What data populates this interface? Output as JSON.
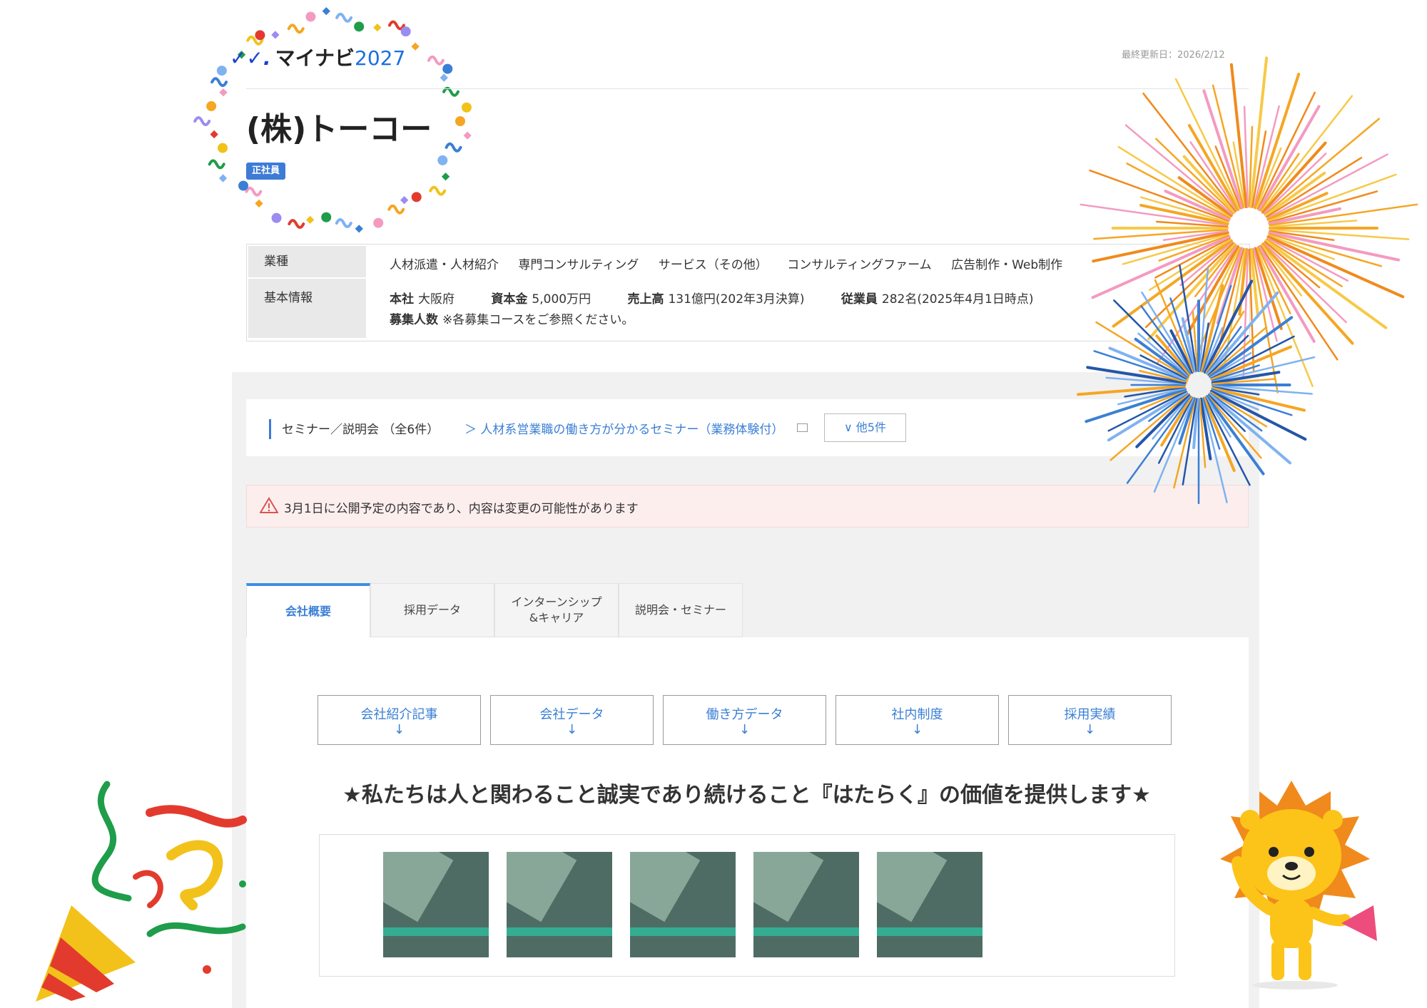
{
  "brand": {
    "logo_text": "マイナビ",
    "logo_year": "2027"
  },
  "last_updated": "最終更新日：2026/2/12",
  "company": {
    "name": "(株)トーコー",
    "employment_type": "正社員"
  },
  "info": {
    "industry_label": "業種",
    "industries": [
      "人材派遣・人材紹介",
      "専門コンサルティング",
      "サービス（その他）",
      "コンサルティングファーム",
      "広告制作・Web制作"
    ],
    "basic_label": "基本情報",
    "hq_label": "本社",
    "hq_value": "大阪府",
    "capital_label": "資本金",
    "capital_value": "5,000万円",
    "sales_label": "売上高",
    "sales_value": "131億円(202年3月決算)",
    "employees_label": "従業員",
    "employees_value": "282名(2025年4月1日時点)",
    "recruit_label": "募集人数",
    "recruit_value": "※各募集コースをご参照ください。"
  },
  "seminar": {
    "label": "セミナー／説明会 （全6件）",
    "link": "＞ 人材系営業職の働き方が分かるセミナー（業務体験付）",
    "more_button": "∨ 他5件"
  },
  "notice": "3月1日に公開予定の内容であり、内容は変更の可能性があります",
  "tabs": [
    {
      "label": "会社概要",
      "active": true
    },
    {
      "label": "採用データ",
      "active": false
    },
    {
      "label": "インターンシップ\n&キャリア",
      "active": false
    },
    {
      "label": "説明会・セミナー",
      "active": false
    }
  ],
  "anchors": [
    {
      "label": "会社紹介記事",
      "arrow": "↓"
    },
    {
      "label": "会社データ",
      "arrow": "↓"
    },
    {
      "label": "働き方データ",
      "arrow": "↓"
    },
    {
      "label": "社内制度",
      "arrow": "↓"
    },
    {
      "label": "採用実績",
      "arrow": "↓"
    }
  ],
  "catchphrase": "★私たちは人と関わること誠実であり続けること『はたらく』の価値を提供します★",
  "photos_count": 5,
  "colors": {
    "accent": "#3d7bd6",
    "link": "#3a7fd5",
    "notice_bg": "#fdeeee",
    "tab_accent": "#3d8fe0"
  },
  "decorations": [
    "confetti-ring",
    "fireworks",
    "party-popper",
    "lion-mascot"
  ]
}
